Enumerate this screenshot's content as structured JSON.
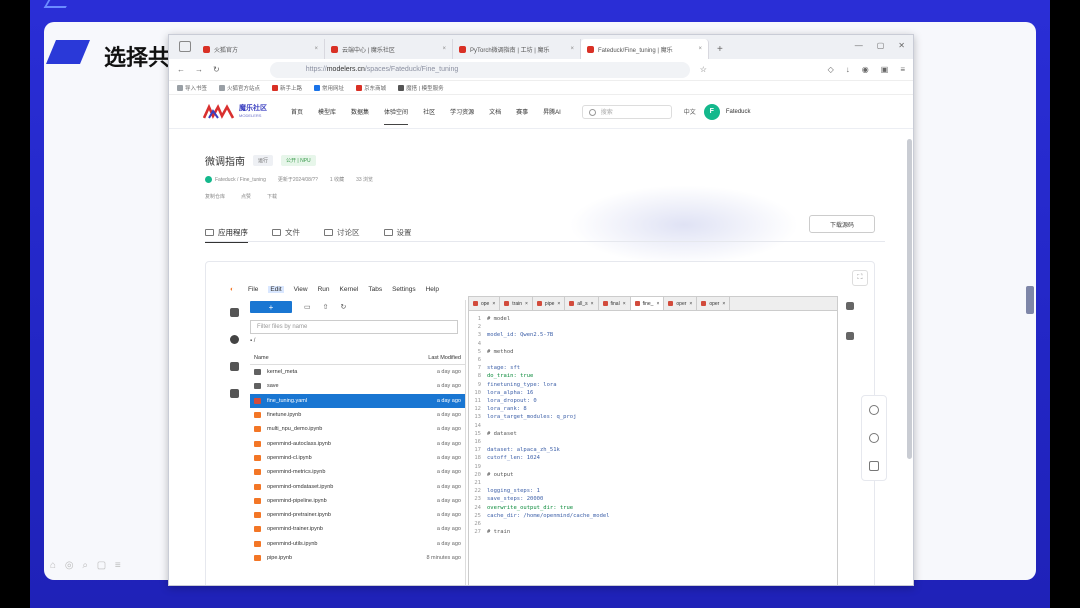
{
  "slide": {
    "title": "选择共",
    "footer": "⌂ ◎ ⌕ ▢ ≡"
  },
  "browser": {
    "tabs": [
      {
        "label": "火狐官方",
        "active": false
      },
      {
        "label": "云端中心 | 魔乐社区",
        "active": false
      },
      {
        "label": "PyTorch微调指南 | 工坊 | 魔乐",
        "active": false
      },
      {
        "label": "Fateduck/Fine_tuning | 魔乐",
        "active": true
      }
    ],
    "new_tab": "+",
    "url_prefix": "https://",
    "url_host": "modelers.cn",
    "url_path": "/spaces/Fateduck/Fine_tuning",
    "bookmarks": [
      {
        "label": "导入书签",
        "color": "#9aa0a6"
      },
      {
        "label": "火狐官方站点",
        "color": "#9aa0a6"
      },
      {
        "label": "新手上路",
        "color": "#d93025"
      },
      {
        "label": "常用网址",
        "color": "#1a73e8"
      },
      {
        "label": "京东商城",
        "color": "#d93025"
      },
      {
        "label": "魔搭 | 模型服务",
        "color": "#555"
      }
    ]
  },
  "site": {
    "logo_text": "魔乐社区",
    "logo_sub": "MODELERS",
    "nav": [
      "首页",
      "模型库",
      "数据集",
      "体验空间",
      "社区",
      "学习资源",
      "文档",
      "赛事",
      "昇腾AI"
    ],
    "nav_active": "体验空间",
    "search_placeholder": "搜索",
    "lang": "中文",
    "avatar_letter": "F",
    "username": "Fateduck"
  },
  "space": {
    "title": "微调指南",
    "badge1": "运行",
    "badge2": "公开 | NPU",
    "owner": "Fateduck / Fine_tuning",
    "updated": "更新于2024/08/??",
    "likes": "1 收藏",
    "views": "33 浏览",
    "meta2": [
      "复制仓库",
      "点赞",
      "下载"
    ],
    "tabs": [
      "应用程序",
      "文件",
      "讨论区",
      "设置"
    ],
    "download_btn": "下载源码"
  },
  "jupyter": {
    "menu": [
      "File",
      "Edit",
      "View",
      "Run",
      "Kernel",
      "Tabs",
      "Settings",
      "Help"
    ],
    "menu_active": "Edit",
    "new_btn": "+",
    "filter_placeholder": "Filter files by name",
    "crumb": "/",
    "col_name": "Name",
    "col_modified": "Last Modified",
    "files": [
      {
        "name": "kernel_meta",
        "date": "a day ago",
        "type": "folder",
        "selected": false
      },
      {
        "name": "save",
        "date": "a day ago",
        "type": "folder",
        "selected": false
      },
      {
        "name": "fine_tuning.yaml",
        "date": "a day ago",
        "type": "yml",
        "selected": true
      },
      {
        "name": "finetune.ipynb",
        "date": "a day ago",
        "type": "nb",
        "selected": false
      },
      {
        "name": "multi_npu_demo.ipynb",
        "date": "a day ago",
        "type": "nb",
        "selected": false
      },
      {
        "name": "openmind-autoclass.ipynb",
        "date": "a day ago",
        "type": "nb",
        "selected": false
      },
      {
        "name": "openmind-cl.ipynb",
        "date": "a day ago",
        "type": "nb",
        "selected": false
      },
      {
        "name": "openmind-metrics.ipynb",
        "date": "a day ago",
        "type": "nb",
        "selected": false
      },
      {
        "name": "openmind-omdataset.ipynb",
        "date": "a day ago",
        "type": "nb",
        "selected": false
      },
      {
        "name": "openmind-pipeline.ipynb",
        "date": "a day ago",
        "type": "nb",
        "selected": false
      },
      {
        "name": "openmind-pretrainer.ipynb",
        "date": "a day ago",
        "type": "nb",
        "selected": false
      },
      {
        "name": "openmind-trainer.ipynb",
        "date": "a day ago",
        "type": "nb",
        "selected": false
      },
      {
        "name": "openmind-utils.ipynb",
        "date": "a day ago",
        "type": "nb",
        "selected": false
      },
      {
        "name": "pipe.ipynb",
        "date": "8 minutes ago",
        "type": "nb",
        "selected": false
      }
    ],
    "editor_tabs": [
      {
        "label": "ope",
        "active": false
      },
      {
        "label": "train",
        "active": false
      },
      {
        "label": "pipe",
        "active": false
      },
      {
        "label": "all_s",
        "active": false
      },
      {
        "label": "final",
        "active": false
      },
      {
        "label": "fine_",
        "active": true
      },
      {
        "label": "oper",
        "active": false
      },
      {
        "label": "oper",
        "active": false
      }
    ],
    "code": [
      {
        "n": "1",
        "t": "# model",
        "c": "cm"
      },
      {
        "n": "2",
        "t": "",
        "c": "cm"
      },
      {
        "n": "3",
        "t": "model_id: Qwen2.5-7B",
        "c": "kv"
      },
      {
        "n": "4",
        "t": "",
        "c": "cm"
      },
      {
        "n": "5",
        "t": "# method",
        "c": "cm"
      },
      {
        "n": "6",
        "t": "",
        "c": "cm"
      },
      {
        "n": "7",
        "t": "stage: sft",
        "c": "kv"
      },
      {
        "n": "8",
        "t": "do_train: true",
        "c": "kb"
      },
      {
        "n": "9",
        "t": "finetuning_type: lora",
        "c": "kv"
      },
      {
        "n": "10",
        "t": "lora_alpha: 16",
        "c": "kv"
      },
      {
        "n": "11",
        "t": "lora_dropout: 0",
        "c": "kv"
      },
      {
        "n": "12",
        "t": "lora_rank: 8",
        "c": "kv"
      },
      {
        "n": "13",
        "t": "lora_target_modules: q_proj",
        "c": "kv"
      },
      {
        "n": "14",
        "t": "",
        "c": "cm"
      },
      {
        "n": "15",
        "t": "# dataset",
        "c": "cm"
      },
      {
        "n": "16",
        "t": "",
        "c": "cm"
      },
      {
        "n": "17",
        "t": "dataset: alpaca_zh_51k",
        "c": "kv"
      },
      {
        "n": "18",
        "t": "cutoff_len: 1024",
        "c": "kv"
      },
      {
        "n": "19",
        "t": "",
        "c": "cm"
      },
      {
        "n": "20",
        "t": "# output",
        "c": "cm"
      },
      {
        "n": "21",
        "t": "",
        "c": "cm"
      },
      {
        "n": "22",
        "t": "logging_steps: 1",
        "c": "kv"
      },
      {
        "n": "23",
        "t": "save_steps: 20000",
        "c": "kv"
      },
      {
        "n": "24",
        "t": "overwrite_output_dir: true",
        "c": "kb"
      },
      {
        "n": "25",
        "t": "cache_dir: /home/openmind/cache_model",
        "c": "kv"
      },
      {
        "n": "26",
        "t": "",
        "c": "cm"
      },
      {
        "n": "27",
        "t": "# train",
        "c": "cm"
      }
    ]
  }
}
